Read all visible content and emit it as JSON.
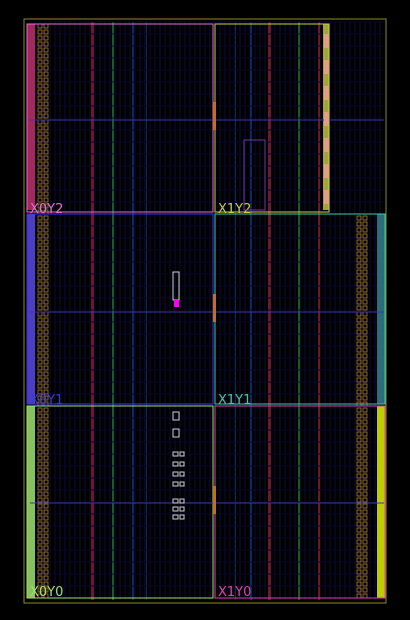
{
  "device_view": {
    "background": "#000000",
    "outline_color": "#8a8a2a",
    "clock_regions": [
      {
        "id": "x0y2",
        "label": "X0Y2",
        "color": "#e070d0",
        "edge": "#c0306a"
      },
      {
        "id": "x1y2",
        "label": "X1Y2",
        "color": "#c8d040",
        "edge": "#c0c040"
      },
      {
        "id": "x0y1",
        "label": "X0Y1",
        "color": "#3838e0",
        "edge": "#5a48e0"
      },
      {
        "id": "x1y1",
        "label": "X1Y1",
        "color": "#40c8b0",
        "edge": "#308090"
      },
      {
        "id": "x0y0",
        "label": "X0Y0",
        "color": "#a0e070",
        "edge": "#a0e070"
      },
      {
        "id": "x1y0",
        "label": "X1Y0",
        "color": "#e040b0",
        "edge": "#e0f000"
      }
    ],
    "selected_marker_color": "#ff00ff"
  }
}
